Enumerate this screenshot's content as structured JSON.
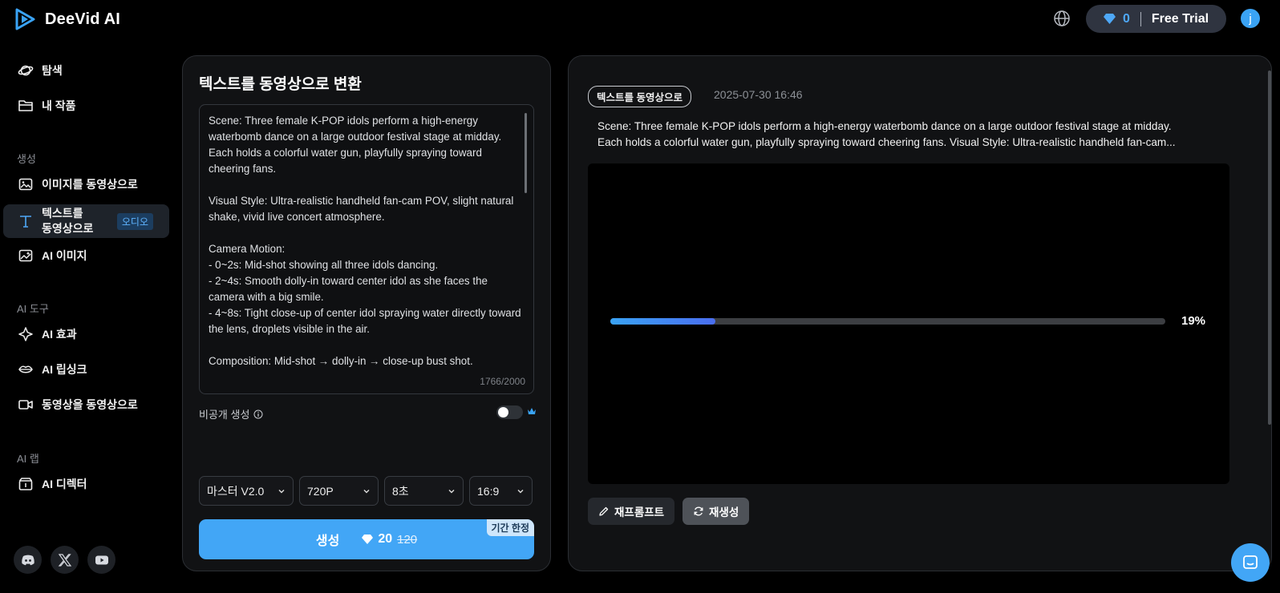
{
  "header": {
    "brand": "DeeVid AI",
    "credits": "0",
    "plan": "Free Trial",
    "avatar_initial": "j"
  },
  "sidebar": {
    "items_top": [
      {
        "label": "탐색",
        "icon": "planet-icon"
      },
      {
        "label": "내 작품",
        "icon": "folder-icon"
      }
    ],
    "section_create": "생성",
    "items_create": [
      {
        "label": "이미지를 동영상으로",
        "icon": "image-icon"
      },
      {
        "label_line1": "텍스트를",
        "label_line2": "동영상으로",
        "icon": "text-t-icon",
        "badge": "오디오",
        "active": true
      },
      {
        "label": "AI 이미지",
        "icon": "ai-image-icon"
      }
    ],
    "section_tools": "AI 도구",
    "items_tools": [
      {
        "label": "AI 효과",
        "icon": "sparkle-icon"
      },
      {
        "label": "AI 립싱크",
        "icon": "lips-icon"
      },
      {
        "label": "동영상을 동영상으로",
        "icon": "video-camera-icon"
      }
    ],
    "section_lab": "AI 랩",
    "items_lab": [
      {
        "label": "AI 디렉터",
        "icon": "director-icon"
      }
    ],
    "social": [
      "discord-icon",
      "x-icon",
      "youtube-icon"
    ]
  },
  "left_panel": {
    "title": "텍스트를 동영상으로 변환",
    "prompt": "Scene: Three female K-POP idols perform a high-energy waterbomb dance on a large outdoor festival stage at midday. Each holds a colorful water gun, playfully spraying toward cheering fans.\n\nVisual Style: Ultra-realistic handheld fan-cam POV, slight natural shake, vivid live concert atmosphere.\n\nCamera Motion:\n- 0~2s: Mid-shot showing all three idols dancing.\n- 2~4s: Smooth dolly-in toward center idol as she faces the camera with a big smile.\n- 4~8s: Tight close-up of center idol spraying water directly toward the lens, droplets visible in the air.\n\nComposition: Mid-shot → dolly-in → close-up bust shot.",
    "char_count": "1766/2000",
    "private_label": "비공개 생성",
    "private_enabled": false,
    "selects": {
      "model": "마스터 V2.0",
      "resolution": "720P",
      "duration": "8초",
      "ratio": "16:9"
    },
    "generate_label": "생성",
    "cost": "20",
    "old_cost": "120",
    "limited_badge": "기간 한정"
  },
  "right_panel": {
    "tag": "텍스트를 동영상으로",
    "date": "2025-07-30 16:46",
    "prompt_line1": "Scene: Three female K-POP idols perform a high-energy waterbomb dance on a large outdoor festival stage at midday.",
    "prompt_line2": "Each holds a colorful water gun, playfully spraying toward cheering fans. Visual Style: Ultra-realistic handheld fan-cam...",
    "progress": 0.19,
    "progress_label": "19%",
    "reprompt_label": "재프롬프트",
    "regenerate_label": "재생성"
  },
  "colors": {
    "accent": "#42a6f6",
    "background": "#000000",
    "panel": "#111214"
  }
}
